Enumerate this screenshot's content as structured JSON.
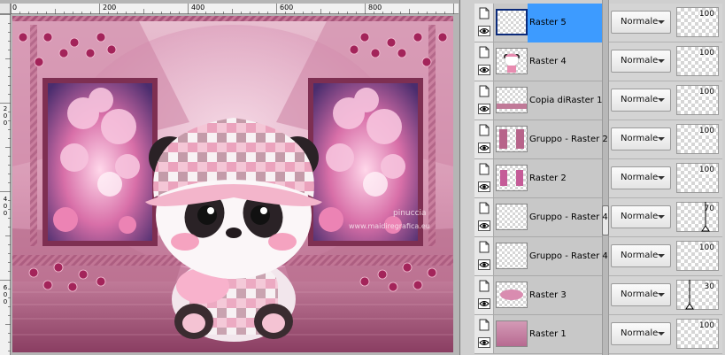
{
  "ruler": {
    "top_labels": [
      "0",
      "200",
      "400",
      "600",
      "800"
    ],
    "left_labels": [
      "2",
      "0",
      "0",
      "4",
      "0",
      "0",
      "6",
      "0",
      "0"
    ]
  },
  "artwork": {
    "watermark_line1": "pinuccia",
    "watermark_line2": "www.maidiregrafica.eu",
    "colors": {
      "pink": "#d48aa8",
      "deep_pink": "#a8476e",
      "light_pink": "#f2c9d8"
    }
  },
  "layers": [
    {
      "name": "Raster 5",
      "blend": "Normale",
      "opacity": "100",
      "selected": true,
      "thumb": "blank",
      "marker": null
    },
    {
      "name": "Raster 4",
      "blend": "Normale",
      "opacity": "100",
      "selected": false,
      "thumb": "panda",
      "marker": null
    },
    {
      "name": "Copia diRaster 1",
      "blend": "Normale",
      "opacity": "100",
      "selected": false,
      "thumb": "stripe",
      "marker": null
    },
    {
      "name": "Gruppo - Raster 2",
      "blend": "Normale",
      "opacity": "100",
      "selected": false,
      "thumb": "frames",
      "marker": null
    },
    {
      "name": "Raster 2",
      "blend": "Normale",
      "opacity": "100",
      "selected": false,
      "thumb": "pictures",
      "marker": null
    },
    {
      "name": "Gruppo - Raster 4",
      "blend": "Normale",
      "opacity": "70",
      "selected": false,
      "thumb": "blank",
      "marker": 0.7
    },
    {
      "name": "Gruppo - Raster 4",
      "blend": "Normale",
      "opacity": "100",
      "selected": false,
      "thumb": "blank",
      "marker": null
    },
    {
      "name": "Raster 3",
      "blend": "Normale",
      "opacity": "30",
      "selected": false,
      "thumb": "oval",
      "marker": 0.3
    },
    {
      "name": "Raster 1",
      "blend": "Normale",
      "opacity": "100",
      "selected": false,
      "thumb": "pinkfill",
      "marker": null
    }
  ],
  "icons": {
    "page": "page-icon",
    "eye": "eye-icon",
    "dropdown": "chevron-down-icon"
  },
  "colors": {
    "selection": "#3d9bff",
    "panel": "#cfcfcf"
  }
}
